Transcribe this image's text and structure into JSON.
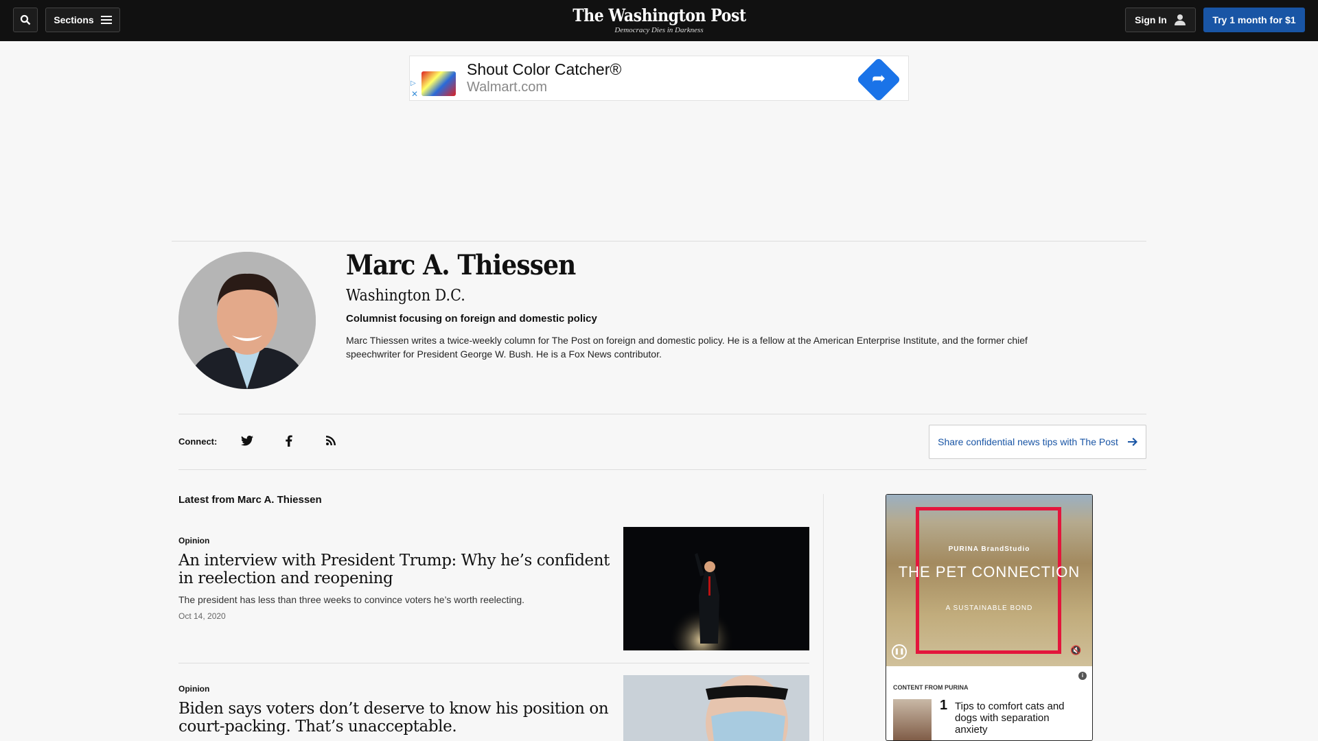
{
  "header": {
    "logo": "The Washington Post",
    "tagline": "Democracy Dies in Darkness",
    "sections_label": "Sections",
    "signin_label": "Sign In",
    "subscribe_label": "Try 1 month for $1"
  },
  "banner_ad": {
    "title": "Shout Color Catcher®",
    "url": "Walmart.com"
  },
  "author": {
    "name": "Marc A. Thiessen",
    "location": "Washington D.C.",
    "role": "Columnist focusing on foreign and domestic policy",
    "bio": "Marc Thiessen writes a twice-weekly column for The Post on foreign and domestic policy. He is a fellow at the American Enterprise Institute, and the former chief speechwriter for President George W. Bush. He is a Fox News contributor."
  },
  "connect": {
    "label": "Connect:",
    "icons": [
      "twitter-icon",
      "facebook-icon",
      "rss-icon"
    ],
    "tips_label": "Share confidential news tips with The Post"
  },
  "latest": {
    "title": "Latest from Marc A. Thiessen",
    "articles": [
      {
        "kicker": "Opinion",
        "headline": "An interview with President Trump: Why he’s confident in reelection and reopening",
        "blurb": "The president has less than three weeks to convince voters he’s worth reelecting.",
        "date": "Oct 14, 2020"
      },
      {
        "kicker": "Opinion",
        "headline": "Biden says voters don’t deserve to know his position on court-packing. That’s unacceptable."
      }
    ]
  },
  "side_ad": {
    "brand": "PURINA   BrandStudio",
    "heading": "THE PET CONNECTION",
    "subheading": "A SUSTAINABLE BOND",
    "content_label": "CONTENT FROM PURINA",
    "item_number": "1",
    "item_text": "Tips to comfort cats and dogs with separation anxiety"
  },
  "colors": {
    "topbar": "#111111",
    "accent": "#1955a5",
    "background": "#f7f7f7"
  }
}
